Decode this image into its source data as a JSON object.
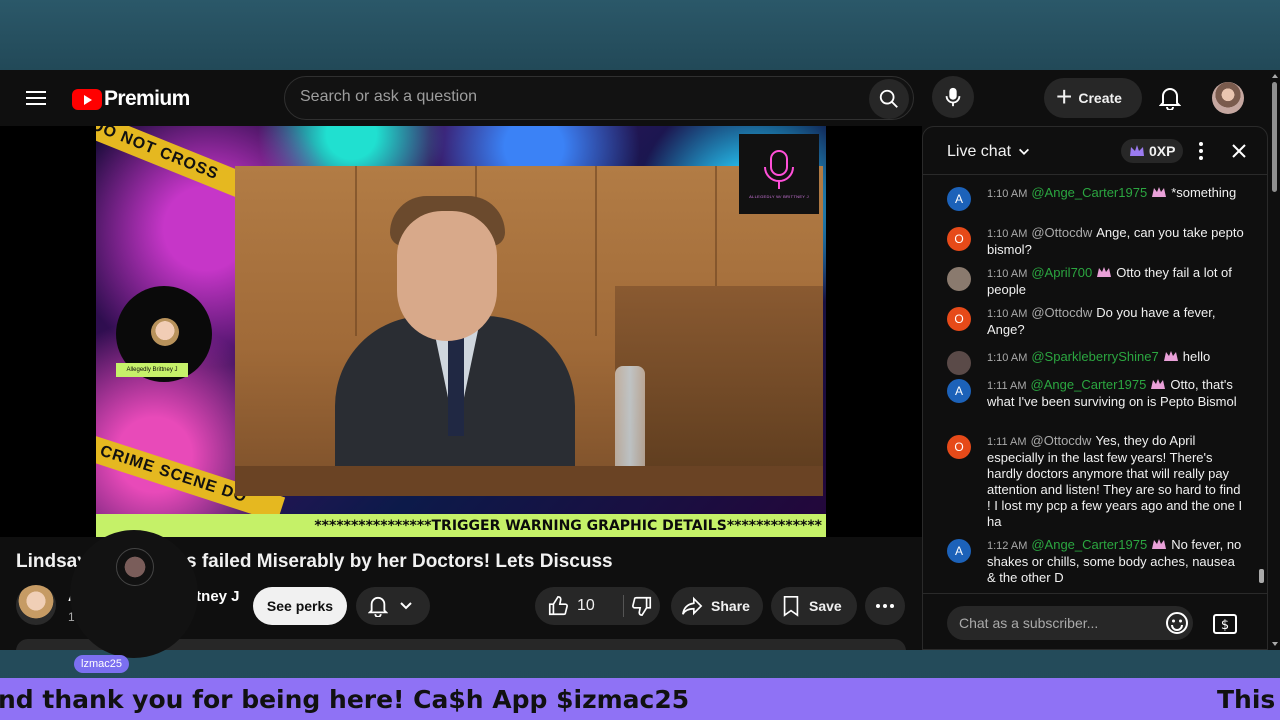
{
  "header": {
    "logo_text": "Premium",
    "search_placeholder": "Search or ask a question",
    "create_label": "Create"
  },
  "video": {
    "tape_top": "DO NOT CROSS",
    "tape_bottom": "CRIME SCENE DO",
    "badge_brand": "ALLEGEDLY W/ BRITTNEY J",
    "profile_tag": "Allegedly Brittney J",
    "warning": "****************TRIGGER WARNING GRAPHIC DETAILS*************",
    "title": "Lindsay Clancy was failed Miserably by her Doctors! Lets Discuss"
  },
  "channel": {
    "name_prefix": "Al",
    "name_suffix": "ittney J",
    "subs": "1",
    "perks_label": "See perks"
  },
  "actions": {
    "like_count": "10",
    "share_label": "Share",
    "save_label": "Save"
  },
  "overlay": {
    "username": "lzmac25"
  },
  "chat": {
    "title": "Live chat",
    "xp": "0XP",
    "input_placeholder": "Chat as a subscriber...",
    "messages": [
      {
        "initial": "A",
        "avatar_color": "#1c62b9",
        "time": "1:10 AM",
        "author": "@Ange_Carter1975",
        "member": true,
        "text": "*something"
      },
      {
        "initial": "O",
        "avatar_color": "#e64a19",
        "time": "1:10 AM",
        "author": "@Ottocdw",
        "member": false,
        "text": "Ange, can you take pepto bismol?"
      },
      {
        "initial": "",
        "avatar_color": "#8a7a6e",
        "time": "1:10 AM",
        "author": "@April700",
        "member": true,
        "text": "Otto they fail a lot of people"
      },
      {
        "initial": "O",
        "avatar_color": "#e64a19",
        "time": "1:10 AM",
        "author": "@Ottocdw",
        "member": false,
        "text": "Do you have a fever, Ange?"
      },
      {
        "initial": "",
        "avatar_color": "#5a4a48",
        "time": "1:10 AM",
        "author": "@SparkleberryShine7",
        "member": true,
        "text": "hello"
      },
      {
        "initial": "A",
        "avatar_color": "#1c62b9",
        "time": "1:11 AM",
        "author": "@Ange_Carter1975",
        "member": true,
        "text": "Otto, that's what I've been surviving on is Pepto Bismol"
      },
      {
        "initial": "O",
        "avatar_color": "#e64a19",
        "time": "1:11 AM",
        "author": "@Ottocdw",
        "member": false,
        "text": "Yes, they do April especially in the last few years! There's hardly doctors anymore that will really pay attention and listen! They are so hard to find ! I lost my pcp a few years ago and the one I ha"
      },
      {
        "initial": "A",
        "avatar_color": "#1c62b9",
        "time": "1:12 AM",
        "author": "@Ange_Carter1975",
        "member": true,
        "text": "No fever, no shakes or chills, some body aches, nausea & the other D"
      }
    ]
  },
  "ticker": {
    "segment_1": "nd thank you for being here! Ca$h App $izmac25",
    "segment_2": "This c"
  }
}
